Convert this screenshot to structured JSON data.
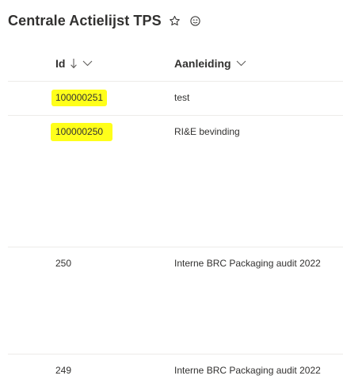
{
  "page": {
    "title": "Centrale Actielijst TPS",
    "favorite_icon": "star-outline-icon",
    "sync_icon": "smiley-sync-icon"
  },
  "columns": {
    "id": {
      "label": "Id",
      "sort": "descending"
    },
    "aanleiding": {
      "label": "Aanleiding"
    }
  },
  "rows": [
    {
      "id": "100000251",
      "aanleiding": "test",
      "highlighted": true
    },
    {
      "id": "100000250",
      "aanleiding": "RI&E bevinding",
      "highlighted": true
    },
    {
      "id": "250",
      "aanleiding": "Interne BRC Packaging audit 2022",
      "highlighted": false
    },
    {
      "id": "249",
      "aanleiding": "Interne BRC Packaging audit 2022",
      "highlighted": false
    }
  ],
  "colors": {
    "highlight": "#ffff1a",
    "divider": "#edebe9",
    "text": "#323130"
  }
}
